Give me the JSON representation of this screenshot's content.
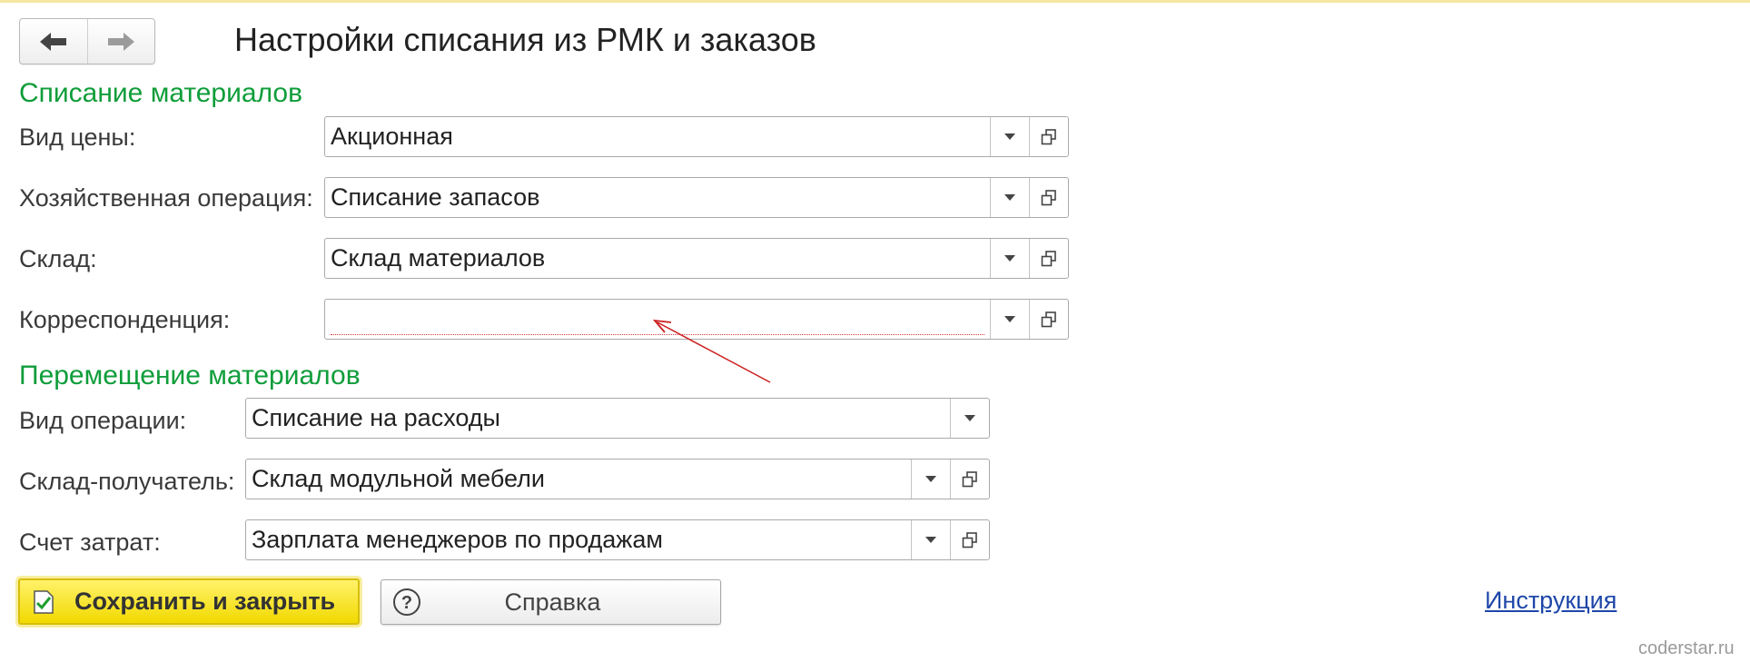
{
  "window": {
    "title": "Настройки списания из РМК и заказов"
  },
  "navigation": {
    "back_icon": "arrow-left-icon",
    "forward_icon": "arrow-right-icon"
  },
  "writeoff_section": {
    "heading": "Списание материалов",
    "fields": [
      {
        "label": "Вид цены:",
        "value": "Акционная"
      },
      {
        "label": "Хозяйственная операция:",
        "value": "Списание запасов"
      },
      {
        "label": "Склад:",
        "value": "Склад материалов"
      },
      {
        "label": "Корреспонденция:",
        "value": ""
      }
    ]
  },
  "transfer_section": {
    "heading": "Перемещение материалов",
    "fields": [
      {
        "label": "Вид операции:",
        "value": "Списание на расходы"
      },
      {
        "label": "Склад-получатель:",
        "value": "Склад модульной мебели"
      },
      {
        "label": "Счет затрат:",
        "value": "Зарплата менеджеров по продажам"
      }
    ]
  },
  "buttons": {
    "save_close": "Сохранить и закрыть",
    "help": "Справка",
    "instructions_link": "Инструкция"
  },
  "watermark": "coderstar.ru",
  "colors": {
    "section_heading": "#0f9d3a",
    "save_button": "#f1d900",
    "link": "#1e47a8",
    "annotation_arrow": "#cc1f1f"
  }
}
